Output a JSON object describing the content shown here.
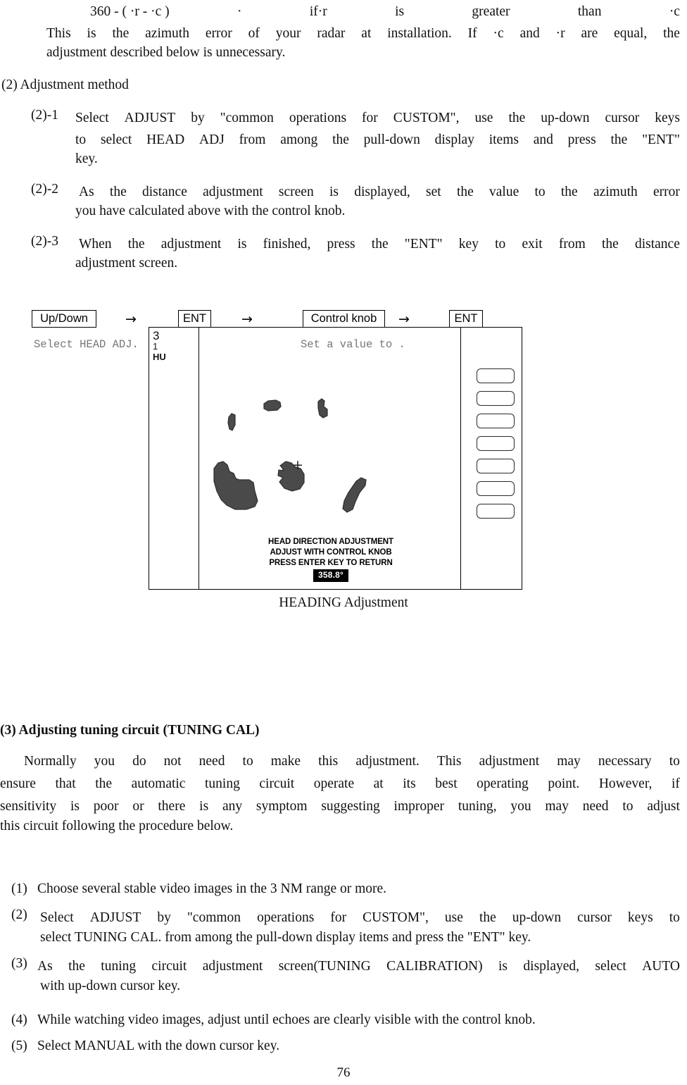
{
  "formula_line": {
    "segments": [
      "360 - ( ·r - ·c )",
      "·",
      "if·r",
      "is",
      "greater",
      "than",
      "·c"
    ]
  },
  "intro_paragraph": {
    "line1": [
      "This",
      "is",
      "the",
      "azimuth",
      "error",
      "of",
      "your",
      "radar",
      "at",
      "installation.",
      "If",
      "·c",
      "and",
      "·r",
      "are",
      "equal,",
      "the"
    ],
    "line2": "adjustment described below is unnecessary."
  },
  "section2": {
    "heading": "(2) Adjustment method",
    "steps": [
      {
        "marker": "(2)-1",
        "lines": [
          [
            "Select",
            "ADJUST",
            "by",
            "\"common",
            "operations",
            "for",
            "CUSTOM\",",
            "use",
            "the",
            "up-down",
            "cursor",
            "keys"
          ],
          [
            "to",
            "select",
            "HEAD",
            "ADJ",
            "from",
            "among",
            "the",
            "pull-down",
            "display",
            "items",
            "and",
            "press",
            "the",
            "\"ENT\""
          ],
          "key."
        ]
      },
      {
        "marker": "(2)-2",
        "lines": [
          [
            "As",
            "the",
            "distance",
            "adjustment",
            "screen",
            "is",
            "displayed,",
            "set",
            "the",
            "value",
            "to",
            "the",
            "azimuth",
            "error"
          ],
          "you have calculated above with the control knob."
        ]
      },
      {
        "marker": "(2)-3",
        "lines": [
          [
            "When",
            "the",
            "adjustment",
            "is",
            "finished,",
            "press",
            "the",
            "\"ENT\"",
            "key",
            "to",
            "exit",
            "from",
            "the",
            "distance"
          ],
          "adjustment screen."
        ]
      }
    ]
  },
  "flow": {
    "key_updown": "Up/Down",
    "arrow1": "→",
    "key_ent1": "ENT",
    "arrow2": "→",
    "key_control_knob": "Control knob",
    "arrow3": "→",
    "key_ent2": "ENT",
    "note_left": "Select HEAD ADJ.",
    "note_right": "Set a value to ."
  },
  "radar": {
    "left_labels": [
      "3",
      "1",
      "HU"
    ],
    "cross_marker": "+",
    "osd_line1": "HEAD DIRECTION ADJUSTMENT",
    "osd_line2": "ADJUST WITH CONTROL KNOB",
    "osd_line3": "PRESS ENTER KEY TO RETURN",
    "value": "358.8°",
    "softkey_count": 7,
    "echo_color": "#4a4a4a",
    "caption": "HEADING Adjustment"
  },
  "section3": {
    "heading": "(3) Adjusting tuning circuit (TUNING CAL)",
    "paragraph_lines": [
      [
        "Normally",
        "you",
        "do",
        "not",
        "need",
        "to",
        "make",
        "this",
        "adjustment.",
        "This",
        "adjustment",
        "may",
        "necessary",
        "to"
      ],
      [
        "ensure",
        "that",
        "the",
        "automatic",
        "tuning",
        "circuit",
        "operate",
        "at",
        "its",
        "best",
        "operating",
        "point.",
        "However,",
        "if"
      ],
      [
        "sensitivity",
        "is",
        "poor",
        "or",
        "there",
        "is",
        "any",
        "symptom",
        "suggesting",
        "improper",
        "tuning,",
        "you",
        "may",
        "need",
        "to",
        "adjust"
      ],
      "this circuit following the procedure below."
    ],
    "steps": [
      {
        "marker": "(1)",
        "lines": [
          "Choose several stable video images in the 3 NM range or more."
        ]
      },
      {
        "marker": "(2)",
        "lines": [
          [
            "Select",
            "ADJUST",
            "by",
            "\"common",
            "operations",
            "for",
            "CUSTOM\",",
            "use",
            "the",
            "up-down",
            "cursor",
            "keys",
            "to"
          ],
          "select TUNING CAL. from among the pull-down display items and press the \"ENT\" key."
        ]
      },
      {
        "marker": "(3)",
        "lines": [
          [
            "As",
            "the",
            "tuning",
            "circuit",
            "adjustment",
            "screen(TUNING",
            "CALIBRATION)",
            "is",
            "displayed,",
            "select",
            "AUTO"
          ],
          "with up-down cursor key."
        ]
      },
      {
        "marker": "(4)",
        "lines": [
          "While watching video images, adjust until echoes are clearly visible with the control knob."
        ]
      },
      {
        "marker": "(5)",
        "lines": [
          "Select MANUAL with the down cursor key."
        ]
      }
    ]
  },
  "page_number": "76"
}
